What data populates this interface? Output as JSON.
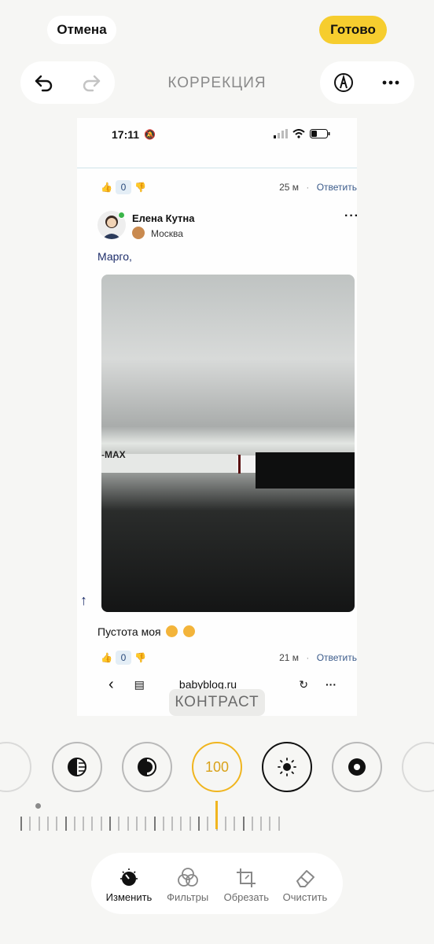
{
  "top": {
    "cancel_label": "Отмена",
    "done_label": "Готово",
    "mode_title": "КОРРЕКЦИЯ"
  },
  "screenshot": {
    "status_time": "17:11",
    "comment1": {
      "like_count": "0",
      "time": "25 м",
      "dot": "·",
      "reply": "Ответить"
    },
    "post": {
      "author": "Елена Кутна",
      "location": "Москва",
      "more": "···",
      "greeting": "Марго,",
      "photo_label": "-MAX",
      "text": "Пустота моя",
      "like_count": "0",
      "time": "21 м",
      "dot": "·",
      "reply": "Ответить"
    },
    "browser": {
      "url": "babyblog.ru"
    }
  },
  "adjustment": {
    "name": "КОНТРАСТ",
    "value": "100"
  },
  "tabs": [
    {
      "label": "Изменить",
      "icon": "adjust-dial-icon"
    },
    {
      "label": "Фильтры",
      "icon": "filters-icon"
    },
    {
      "label": "Обрезать",
      "icon": "crop-icon"
    },
    {
      "label": "Очистить",
      "icon": "eraser-icon"
    }
  ],
  "colors": {
    "accent": "#f6cd2e",
    "active_ring": "#f0b51f"
  }
}
